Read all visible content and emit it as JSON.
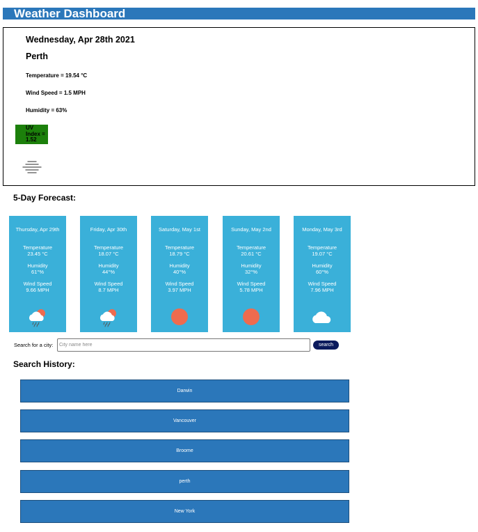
{
  "header": {
    "title": "Weather Dashboard"
  },
  "current": {
    "date": "Wednesday, Apr 28th 2021",
    "city": "Perth",
    "temperature": "Temperature = 19.54 °C",
    "wind": "Wind Speed = 1.5 MPH",
    "humidity": "Humidity = 63%",
    "uv": "UV Index = 1.52",
    "uv_color": "#1c800b",
    "icon": "mist-icon"
  },
  "forecast": {
    "title": "5-Day Forecast:",
    "days": [
      {
        "date": "Thursday, Apr 29th",
        "temp_label": "Temperature",
        "temp": "23.45 °C",
        "hum_label": "Humidity",
        "hum": "61°%",
        "wind_label": "Wind Speed",
        "wind": "9.66 MPH",
        "icon": "rain-cloud-sun-icon"
      },
      {
        "date": "Friday, Apr 30th",
        "temp_label": "Temperature",
        "temp": "18.07 °C",
        "hum_label": "Humidity",
        "hum": "44°%",
        "wind_label": "Wind Speed",
        "wind": "8.7 MPH",
        "icon": "rain-cloud-sun-icon"
      },
      {
        "date": "Saturday, May 1st",
        "temp_label": "Temperature",
        "temp": "18.79 °C",
        "hum_label": "Humidity",
        "hum": "40°%",
        "wind_label": "Wind Speed",
        "wind": "3.97 MPH",
        "icon": "sun-icon"
      },
      {
        "date": "Sunday, May 2nd",
        "temp_label": "Temperature",
        "temp": "20.61 °C",
        "hum_label": "Humidity",
        "hum": "32°%",
        "wind_label": "Wind Speed",
        "wind": "5.78 MPH",
        "icon": "sun-icon"
      },
      {
        "date": "Monday, May 3rd",
        "temp_label": "Temperature",
        "temp": "19.07 °C",
        "hum_label": "Humidity",
        "hum": "60°%",
        "wind_label": "Wind Speed",
        "wind": "7.96 MPH",
        "icon": "cloud-icon"
      }
    ]
  },
  "search": {
    "label": "Search for a city:",
    "placeholder": "City name here",
    "value": "",
    "button": "search"
  },
  "history": {
    "title": "Search History:",
    "items": [
      "Darwin",
      "Vancouver",
      "Broome",
      "perth",
      "New York"
    ]
  },
  "colors": {
    "header": "#2b77ba",
    "card": "#3ab0d9",
    "sun": "#ef6b4e",
    "search_button": "#0b1a5c"
  }
}
